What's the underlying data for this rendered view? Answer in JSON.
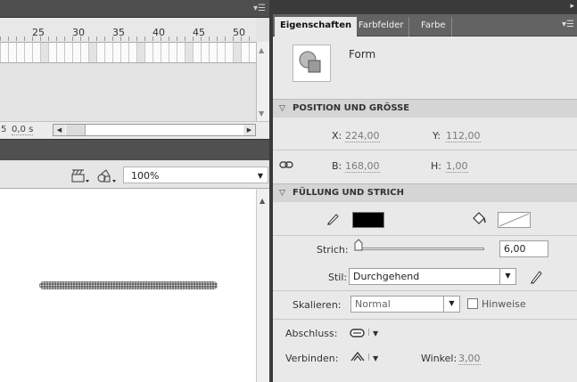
{
  "timeline": {
    "ruler_numbers": [
      "25",
      "30",
      "35",
      "40",
      "45",
      "50"
    ],
    "status_frame": "5",
    "status_time": "0,0 s"
  },
  "stage": {
    "zoom": "100%"
  },
  "panel": {
    "tabs": [
      "Eigenschaften",
      "Farbfelder",
      "Farbe"
    ],
    "symbol_type": "Form",
    "position": {
      "title": "POSITION UND GRÖSSE",
      "x_label": "X:",
      "x_value": "224,00",
      "y_label": "Y:",
      "y_value": "112,00",
      "b_label": "B:",
      "b_value": "168,00",
      "h_label": "H:",
      "h_value": "1,00"
    },
    "fill_stroke": {
      "title": "FÜLLUNG UND STRICH",
      "stroke_color": "#000000",
      "strich_label": "Strich:",
      "strich_value": "6,00",
      "strich_slider": 0.0,
      "stil_label": "Stil:",
      "stil_value": "Durchgehend",
      "skalieren_label": "Skalieren:",
      "skalieren_value": "Normal",
      "hinweise_label": "Hinweise",
      "hinweise_checked": false,
      "abschluss_label": "Abschluss:",
      "verbinden_label": "Verbinden:",
      "winkel_label": "Winkel:",
      "winkel_value": "3,00"
    }
  }
}
